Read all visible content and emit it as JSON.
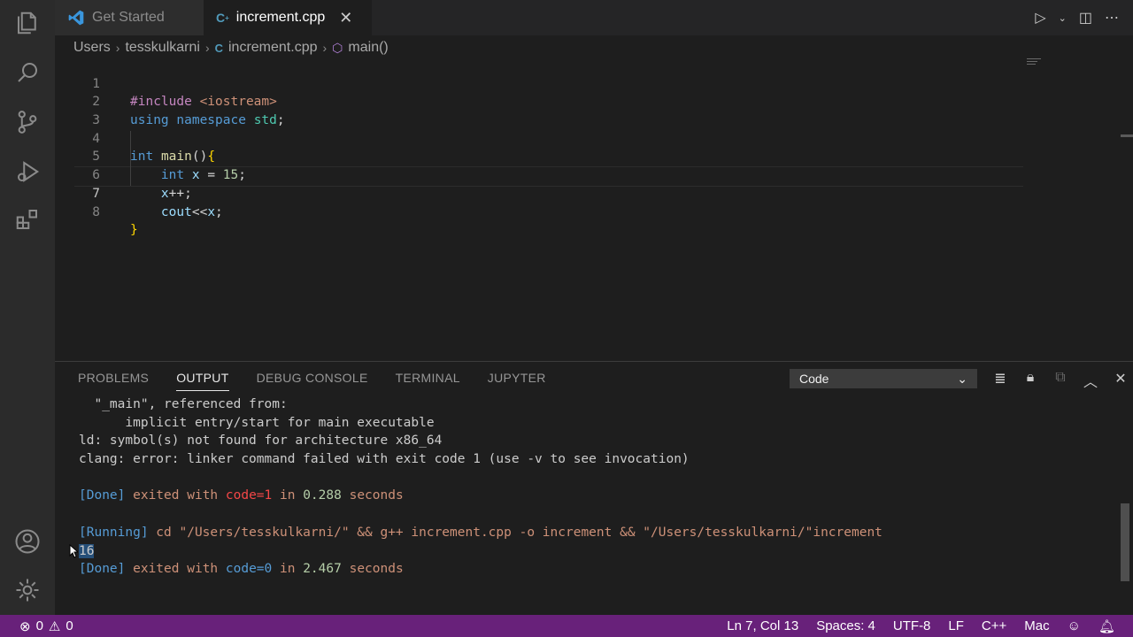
{
  "tabs": [
    {
      "label": "Get Started",
      "active": false
    },
    {
      "label": "increment.cpp",
      "active": true
    }
  ],
  "breadcrumb": [
    "Users",
    "tesskulkarni",
    "increment.cpp",
    "main()"
  ],
  "code_lines": [
    {
      "n": "1",
      "text": "#include <iostream>"
    },
    {
      "n": "2",
      "text": "using namespace std;"
    },
    {
      "n": "3",
      "text": ""
    },
    {
      "n": "4",
      "text": "int main(){"
    },
    {
      "n": "5",
      "text": "    int x = 15;"
    },
    {
      "n": "6",
      "text": "    x++;"
    },
    {
      "n": "7",
      "text": "    cout<<x;"
    },
    {
      "n": "8",
      "text": "}"
    }
  ],
  "code_tokens": {
    "l1a": "#include",
    "l1b": " ",
    "l1c": "<iostream>",
    "l2a": "using",
    "l2b": " ",
    "l2c": "namespace",
    "l2d": " ",
    "l2e": "std",
    "l2f": ";",
    "l4a": "int",
    "l4b": " ",
    "l4c": "main",
    "l4d": "()",
    "l4e": "{",
    "l5a": "    ",
    "l5b": "int",
    "l5c": " ",
    "l5d": "x",
    "l5e": " = ",
    "l5f": "15",
    "l5g": ";",
    "l6a": "    ",
    "l6b": "x",
    "l6c": "++;",
    "l7a": "    ",
    "l7b": "cout",
    "l7c": "<<",
    "l7d": "x",
    "l7e": ";",
    "l8a": "}"
  },
  "panel": {
    "tabs": [
      "PROBLEMS",
      "OUTPUT",
      "DEBUG CONSOLE",
      "TERMINAL",
      "JUPYTER"
    ],
    "active_tab": "OUTPUT",
    "channel": "Code"
  },
  "output": {
    "o1": "  \"_main\", referenced from:",
    "o2": "      implicit entry/start for main executable",
    "o3": "ld: symbol(s) not found for architecture x86_64",
    "o4": "clang: error: linker command failed with exit code 1 (use -v to see invocation)",
    "o5a": "[Done]",
    "o5b": " exited with ",
    "o5c": "code=1",
    "o5d": " in ",
    "o5e": "0.288",
    "o5f": " seconds",
    "o7a": "[Running]",
    "o7b": " cd \"/Users/tesskulkarni/\" && g++ increment.cpp -o increment && \"/Users/tesskulkarni/\"increment",
    "o8": "16",
    "o9a": "[Done]",
    "o9b": " exited with ",
    "o9c": "code=0",
    "o9d": " in ",
    "o9e": "2.467",
    "o9f": " seconds"
  },
  "status": {
    "errors": "0",
    "warnings": "0",
    "position": "Ln 7, Col 13",
    "spaces": "Spaces: 4",
    "encoding": "UTF-8",
    "eol": "LF",
    "language": "C++",
    "platform": "Mac"
  },
  "colors": {
    "status_bar": "#68217a",
    "editor_bg": "#1e1e1e",
    "activity_bar": "#2b2b2b"
  }
}
